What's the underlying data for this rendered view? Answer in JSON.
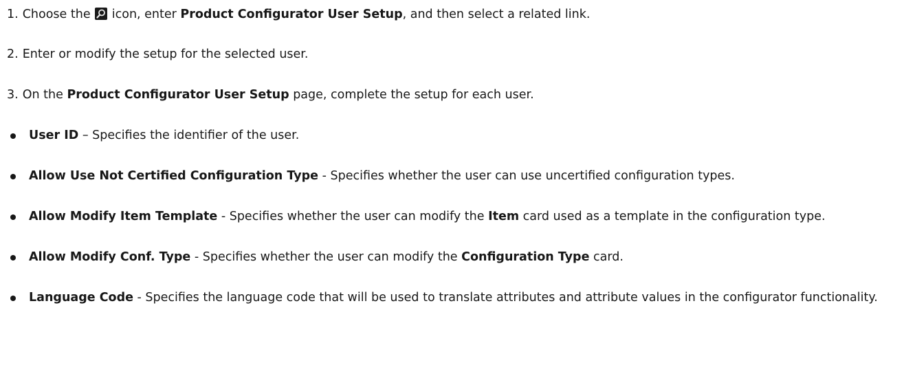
{
  "steps": [
    {
      "number": "1.",
      "t1": "Choose the",
      "t2": "icon, enter",
      "bold1": "Product Configurator User Setup",
      "t3": ", and then select a related link.",
      "icon": "search-icon"
    },
    {
      "number": "2.",
      "t1": "Enter or modify the setup for the selected user."
    },
    {
      "number": "3.",
      "t1": "On the",
      "bold1": "Product Configurator User Setup",
      "t2": "page, complete the setup for each user."
    }
  ],
  "fields": [
    {
      "name": "User ID",
      "desc": " – Specifies the identifier of the user."
    },
    {
      "name": "Allow Use Not Certified Configuration Type",
      "desc": " - Specifies whether the user can use uncertified configuration types."
    },
    {
      "name": "Allow Modify Item Template",
      "desc_a": " - Specifies whether the user can modify the ",
      "bold": "Item",
      "desc_b": " card used as a template in the configuration type."
    },
    {
      "name": "Allow Modify Conf. Type",
      "desc_a": " - Specifies whether the user can modify the ",
      "bold": "Configuration Type",
      "desc_b": " card."
    },
    {
      "name": "Language Code",
      "desc": " - Specifies the language code that will be used to translate attributes and attribute values in the configurator functionality."
    }
  ]
}
